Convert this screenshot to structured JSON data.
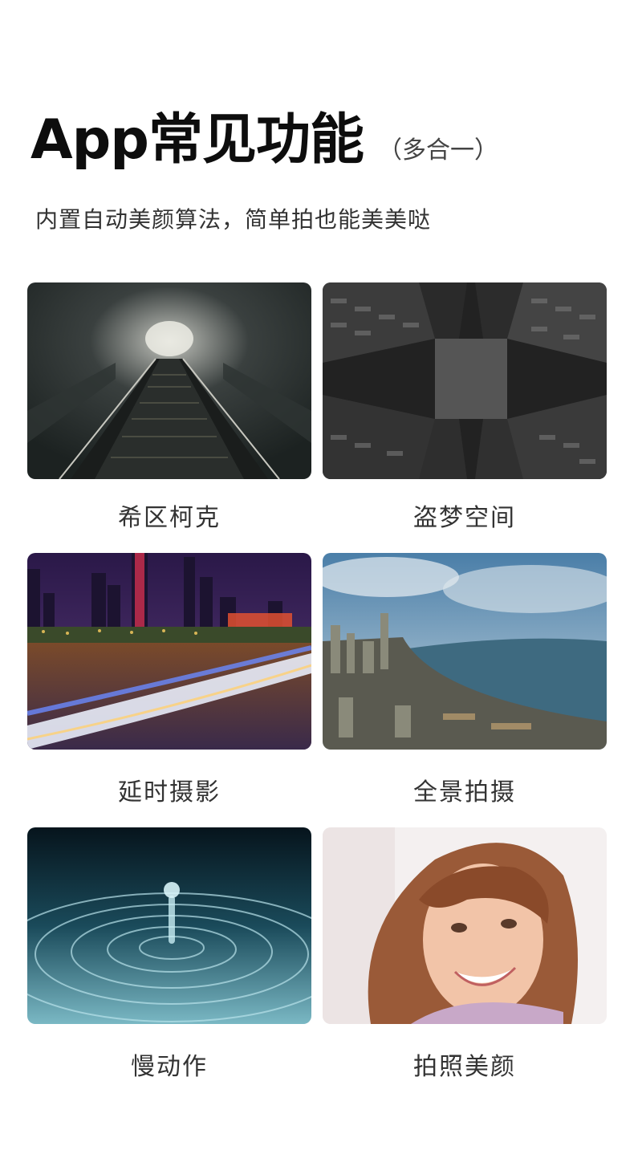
{
  "header": {
    "title": "App常见功能",
    "title_suffix": "（多合一）",
    "subtitle": "内置自动美颜算法，简单拍也能美美哒"
  },
  "features": [
    {
      "label": "希区柯克",
      "image": "escalator-tunnel-photo"
    },
    {
      "label": "盗梦空间",
      "image": "buildings-looking-up-photo"
    },
    {
      "label": "延时摄影",
      "image": "night-city-light-trails-photo"
    },
    {
      "label": "全景拍摄",
      "image": "panoramic-harbor-city-photo"
    },
    {
      "label": "慢动作",
      "image": "water-drop-ripple-photo"
    },
    {
      "label": "拍照美颜",
      "image": "smiling-woman-portrait-photo"
    }
  ]
}
